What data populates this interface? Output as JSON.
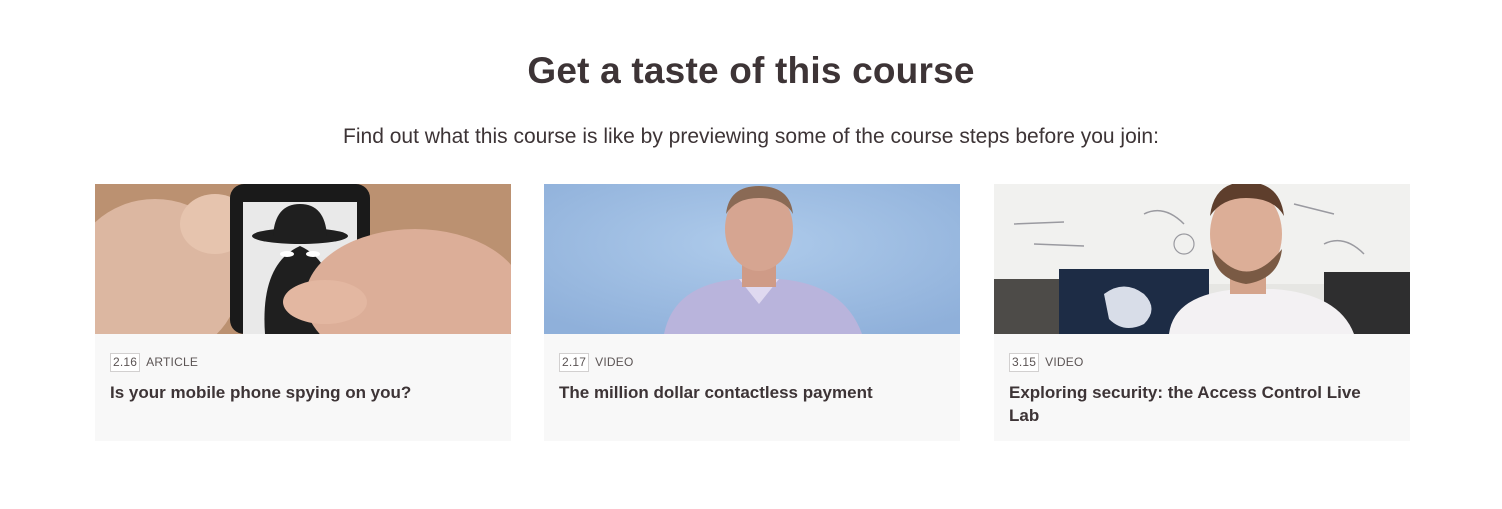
{
  "section": {
    "title": "Get a taste of this course",
    "subtitle": "Find out what this course is like by previewing some of the course steps before you join:"
  },
  "steps": [
    {
      "number": "2.16",
      "type": "ARTICLE",
      "title": "Is your mobile phone spying on you?",
      "image": "spy-on-phone-image"
    },
    {
      "number": "2.17",
      "type": "VIDEO",
      "title": "The million dollar contactless payment",
      "image": "presenter-blue-background-image"
    },
    {
      "number": "3.15",
      "type": "VIDEO",
      "title": "Exploring security: the Access Control Live Lab",
      "image": "presenter-lab-whiteboard-image"
    }
  ],
  "colors": {
    "text": "#3d3436",
    "card_background": "#f8f8f8",
    "meta_text": "#5b5454"
  }
}
